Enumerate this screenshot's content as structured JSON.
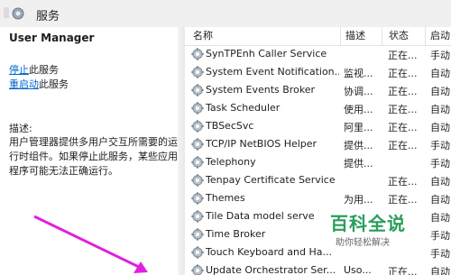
{
  "window": {
    "title": "服务"
  },
  "left_pane": {
    "service_name": "User Manager",
    "stop_link": "停止",
    "stop_suffix": "此服务",
    "restart_link": "重启动",
    "restart_suffix": "此服务",
    "desc_label": "描述:",
    "desc_text": "用户管理器提供多用户交互所需要的运行时组件。如果停止此服务，某些应用程序可能无法正确运行。"
  },
  "table": {
    "columns": [
      "名称",
      "描述",
      "状态",
      "启动"
    ],
    "rows": [
      {
        "name": "SynTPEnh Caller Service",
        "desc": "",
        "status": "正在...",
        "start": "手动"
      },
      {
        "name": "System Event Notification...",
        "desc": "监视...",
        "status": "正在...",
        "start": "自动"
      },
      {
        "name": "System Events Broker",
        "desc": "协调...",
        "status": "正在...",
        "start": "自动"
      },
      {
        "name": "Task Scheduler",
        "desc": "使用...",
        "status": "正在...",
        "start": "自动"
      },
      {
        "name": "TBSecSvc",
        "desc": "阿里...",
        "status": "正在...",
        "start": "自动"
      },
      {
        "name": "TCP/IP NetBIOS Helper",
        "desc": "提供...",
        "status": "正在...",
        "start": "手动"
      },
      {
        "name": "Telephony",
        "desc": "提供...",
        "status": "",
        "start": "手动"
      },
      {
        "name": "Tenpay Certificate Service",
        "desc": "",
        "status": "正在...",
        "start": "自动"
      },
      {
        "name": "Themes",
        "desc": "为用...",
        "status": "正在...",
        "start": "自动"
      },
      {
        "name": "Tile Data model serve",
        "desc": "",
        "status": "",
        "start": "自动"
      },
      {
        "name": "Time Broker",
        "desc": "",
        "status": "",
        "start": "手动"
      },
      {
        "name": "Touch Keyboard and Ha...",
        "desc": "",
        "status": "",
        "start": "手动"
      },
      {
        "name": "Update Orchestrator Ser...",
        "desc": "Uso...",
        "status": "正在...",
        "start": "自动"
      }
    ]
  },
  "watermark": {
    "main": "百科全说",
    "sub": "助你轻松解决"
  },
  "colors": {
    "link": "#0066cc",
    "arrow": "#e020e0",
    "watermark": "#2a9d5c"
  },
  "icons": {
    "service": "gear-icon",
    "app": "services-app-icon"
  }
}
